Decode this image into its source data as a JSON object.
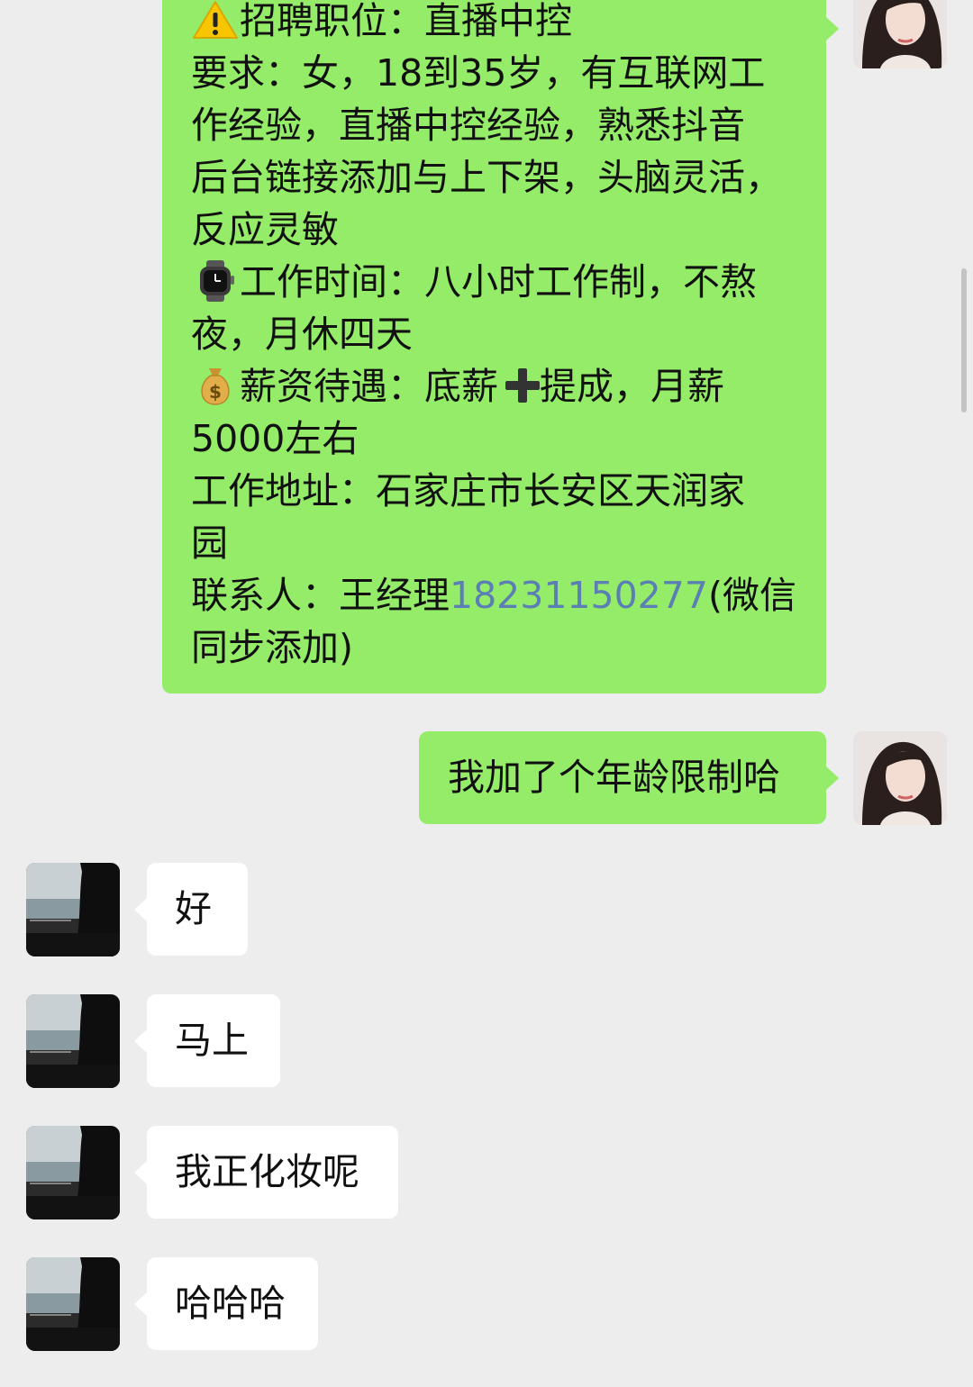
{
  "messages": {
    "job_post": {
      "l1": "招聘职位：直播中控",
      "l2": "要求：女，18到35岁，有互联网工",
      "l3": "作经验，直播中控经验，熟悉抖音",
      "l4": "后台链接添加与上下架，头脑灵活，",
      "l5": "反应灵敏",
      "l6": "工作时间：八小时工作制，不熬",
      "l7": "夜，月休四天",
      "l8a": "薪资待遇：底薪",
      "l8b": "提成，月薪",
      "l9": "5000左右",
      "l10": "工作地址：石家庄市长安区天润家",
      "l11": "园",
      "l12_prefix": "联系人：王经理",
      "l12_phone": "18231150277",
      "l12_suffix": "(微信",
      "l13": "同步添加)"
    },
    "sent_age": "我加了个年龄限制哈",
    "reply_1": "好",
    "reply_2": "马上",
    "reply_3": "我正化妆呢",
    "reply_4": "哈哈哈"
  },
  "icons": {
    "warning": "warning-emoji",
    "watch": "watch-emoji",
    "money_bag": "money-bag-emoji",
    "plus": "heavy-plus-emoji"
  },
  "colors": {
    "background": "#ededed",
    "sent_bubble": "#95ec69",
    "received_bubble": "#ffffff",
    "phone_link": "#5b7fb5"
  }
}
